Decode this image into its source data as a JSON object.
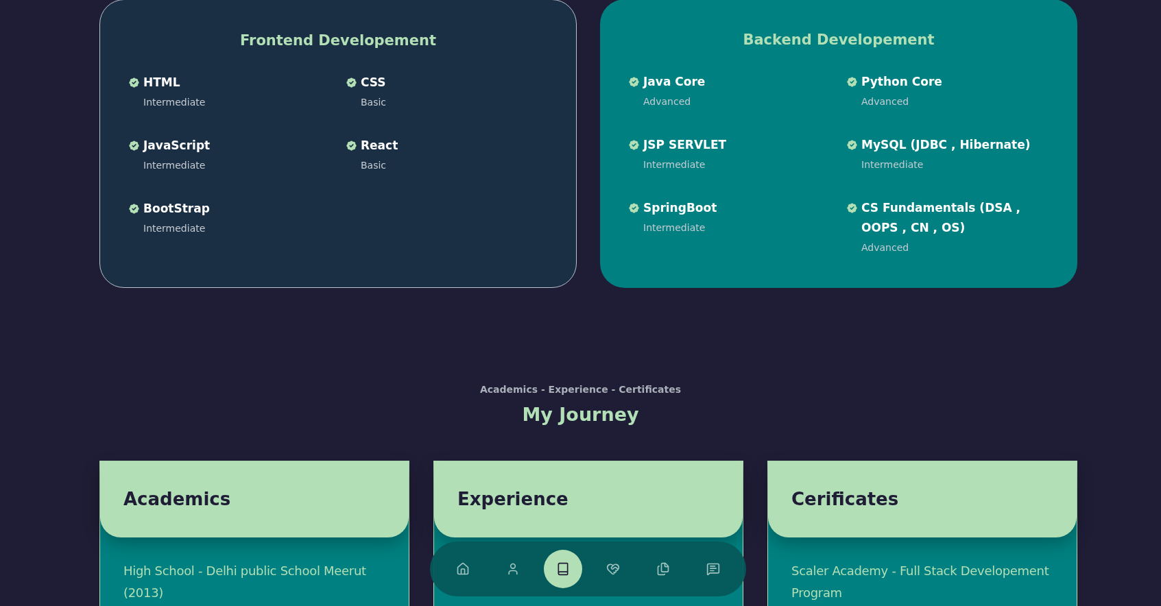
{
  "skill_cards": [
    {
      "title": "Frontend Developement",
      "kind": "outlined",
      "skills": [
        {
          "name": "HTML",
          "level_text": "Intermediate"
        },
        {
          "name": "CSS",
          "level_text": "Basic"
        },
        {
          "name": "JavaScript",
          "level_text": "Intermediate"
        },
        {
          "name": "React",
          "level_text": "Basic"
        },
        {
          "name": "BootStrap",
          "level_text": "Intermediate"
        }
      ]
    },
    {
      "title": "Backend Developement",
      "kind": "filled",
      "skills": [
        {
          "name": "Java Core",
          "level_text": "Advanced"
        },
        {
          "name": "Python Core",
          "level_text": "Advanced"
        },
        {
          "name": "JSP SERVLET",
          "level_text": "Intermediate"
        },
        {
          "name": "MySQL (JDBC , Hibernate)",
          "level_text": "Intermediate"
        },
        {
          "name": "SpringBoot",
          "level_text": "Intermediate"
        },
        {
          "name": "CS Fundamentals (DSA , OOPS , CN , OS)",
          "level_text": "Advanced"
        }
      ]
    }
  ],
  "journey": {
    "subtitle": "Academics - Experience - Certificates",
    "title": "My Journey",
    "cards": [
      {
        "title": "Academics",
        "text": "High School - Delhi public School Meerut (2013)"
      },
      {
        "title": "Experience"
      },
      {
        "title": "Cerificates",
        "text": "Scaler Academy - Full Stack Developement Program"
      }
    ]
  },
  "nav": [
    {
      "kind": "home",
      "selected": false
    },
    {
      "kind": "user",
      "selected": false
    },
    {
      "kind": "book",
      "selected": true
    },
    {
      "kind": "handshake",
      "selected": false
    },
    {
      "kind": "files",
      "selected": false
    },
    {
      "kind": "message",
      "selected": false
    }
  ]
}
